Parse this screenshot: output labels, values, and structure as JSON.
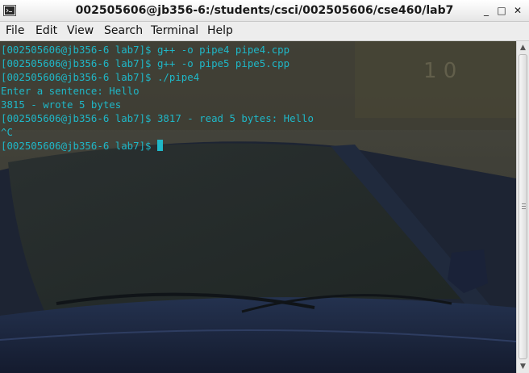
{
  "window": {
    "title": "002505606@jb356-6:/students/csci/002505606/cse460/lab7",
    "controls": {
      "minimize": "_",
      "maximize": "□",
      "close": "✕"
    }
  },
  "menu": [
    "File",
    "Edit",
    "View",
    "Search",
    "Terminal",
    "Help"
  ],
  "terminal": {
    "lines": [
      "[002505606@jb356-6 lab7]$ g++ -o pipe4 pipe4.cpp",
      "[002505606@jb356-6 lab7]$ g++ -o pipe5 pipe5.cpp",
      "[002505606@jb356-6 lab7]$ ./pipe4",
      "Enter a sentence: Hello",
      "3815 - wrote 5 bytes",
      "[002505606@jb356-6 lab7]$ 3817 - read 5 bytes: Hello",
      "^C"
    ],
    "prompt": "[002505606@jb356-6 lab7]$ ",
    "text_color": "#1fb7c7"
  },
  "wallpaper": {
    "description_text": "10",
    "colors": {
      "ground": "#3b3a2e",
      "car_body": "#1c2740"
    }
  },
  "scrollbar": {
    "up": "▲",
    "down": "▼"
  }
}
